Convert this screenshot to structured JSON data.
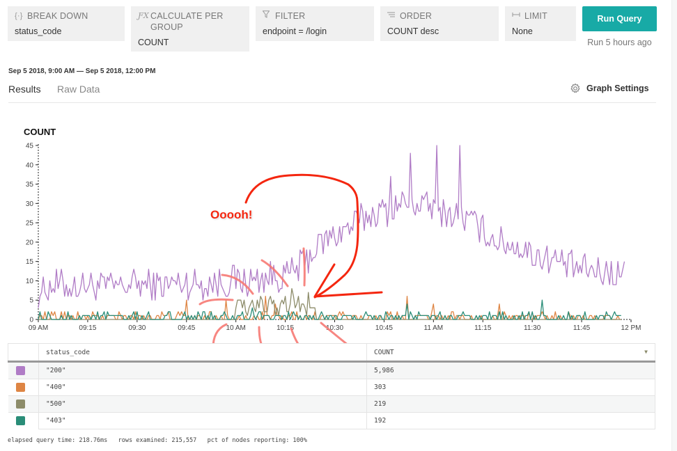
{
  "query": {
    "breakdown": {
      "icon": "breakdown-icon",
      "label": "BREAK DOWN",
      "value": "status_code"
    },
    "calculate": {
      "icon": "function-icon",
      "label": "CALCULATE PER GROUP",
      "value": "COUNT"
    },
    "filter": {
      "icon": "filter-icon",
      "label": "FILTER",
      "value": "endpoint = /login"
    },
    "order": {
      "icon": "order-icon",
      "label": "ORDER",
      "value": "COUNT desc"
    },
    "limit": {
      "icon": "limit-icon",
      "label": "LIMIT",
      "value": "None"
    },
    "run_button": "Run Query",
    "run_status": "Run 5 hours ago"
  },
  "date_range": "Sep 5 2018, 9:00 AM — Sep 5 2018, 12:00 PM",
  "tabs": [
    {
      "label": "Results",
      "active": true
    },
    {
      "label": "Raw Data",
      "active": false
    }
  ],
  "graph_settings": {
    "icon": "gear-icon",
    "label": "Graph Settings"
  },
  "annotation": {
    "text": "Ooooh!",
    "color": "#f4260f"
  },
  "chart_data": {
    "type": "line",
    "title": "COUNT",
    "xlabel": "",
    "ylabel": "",
    "x_range": [
      "09:00",
      "12:00"
    ],
    "ylim": [
      0,
      45
    ],
    "yticks": [
      0,
      5,
      10,
      15,
      20,
      25,
      30,
      35,
      40,
      45
    ],
    "xticks": [
      "09 AM",
      "09:15",
      "09:30",
      "09:45",
      "10 AM",
      "10:15",
      "10:30",
      "10:45",
      "11 AM",
      "11:15",
      "11:30",
      "11:45",
      "12 PM"
    ],
    "grid": false,
    "legend": "table-below",
    "series": [
      {
        "name": "\"200\"",
        "color": "#b07cc6",
        "anchors": [
          [
            0,
            7
          ],
          [
            5,
            9
          ],
          [
            10,
            8.5
          ],
          [
            15,
            9
          ],
          [
            20,
            8.5
          ],
          [
            25,
            8.5
          ],
          [
            30,
            9
          ],
          [
            35,
            9
          ],
          [
            40,
            9
          ],
          [
            45,
            9.5
          ],
          [
            50,
            9
          ],
          [
            55,
            9.5
          ],
          [
            60,
            10
          ],
          [
            65,
            10
          ],
          [
            70,
            11
          ],
          [
            75,
            11
          ],
          [
            80,
            14
          ],
          [
            85,
            19
          ],
          [
            90,
            22
          ],
          [
            95,
            24
          ],
          [
            100,
            27
          ],
          [
            105,
            28
          ],
          [
            110,
            30
          ],
          [
            115,
            30
          ],
          [
            120,
            29
          ],
          [
            125,
            27
          ],
          [
            130,
            26
          ],
          [
            135,
            23
          ],
          [
            140,
            20
          ],
          [
            145,
            19
          ],
          [
            150,
            17
          ],
          [
            155,
            16
          ],
          [
            160,
            14
          ],
          [
            165,
            13
          ],
          [
            170,
            12.5
          ],
          [
            175,
            12
          ],
          [
            178,
            12
          ]
        ],
        "noise": 4,
        "peaks": [
          [
            121,
            45
          ],
          [
            128,
            44.5
          ],
          [
            113,
            43
          ],
          [
            107,
            37
          ]
        ]
      },
      {
        "name": "\"400\"",
        "color": "#de8544",
        "base": 0.6,
        "noise": 1.5,
        "spikes": [
          [
            7,
            2
          ],
          [
            45,
            5
          ],
          [
            57,
            5
          ],
          [
            69,
            6
          ],
          [
            72,
            4
          ],
          [
            112,
            6
          ],
          [
            120,
            4
          ],
          [
            140,
            4
          ]
        ],
        "end": 177
      },
      {
        "name": "\"500\"",
        "color": "#8d8c6a",
        "base": 0,
        "noise": 0.4,
        "end": 177,
        "bump": {
          "start": 60,
          "end": 84,
          "level": 3.5,
          "noise": 3.5,
          "peaks": [
            [
              77,
              8
            ],
            [
              79,
              6
            ],
            [
              82,
              7
            ]
          ]
        }
      },
      {
        "name": "\"403\"",
        "color": "#2a8d78",
        "base": 0.6,
        "noise": 1.5,
        "end": 177,
        "spikes": [
          [
            65,
            3
          ],
          [
            153,
            5
          ],
          [
            112,
            3.5
          ]
        ]
      }
    ],
    "x_unit": "minutes since 09:00"
  },
  "table": {
    "columns": [
      "status_code",
      "COUNT"
    ],
    "sort_indicator": "sort-desc-icon",
    "rows": [
      {
        "color": "#b07cc6",
        "status_code": "\"200\"",
        "count": "5,986"
      },
      {
        "color": "#de8544",
        "status_code": "\"400\"",
        "count": "303"
      },
      {
        "color": "#8d8c6a",
        "status_code": "\"500\"",
        "count": "219"
      },
      {
        "color": "#2a8d78",
        "status_code": "\"403\"",
        "count": "192"
      }
    ]
  },
  "footer": {
    "elapsed": "elapsed query time: 218.76ms",
    "rows": "rows examined: 215,557",
    "nodes": "pct of nodes reporting: 100%"
  }
}
